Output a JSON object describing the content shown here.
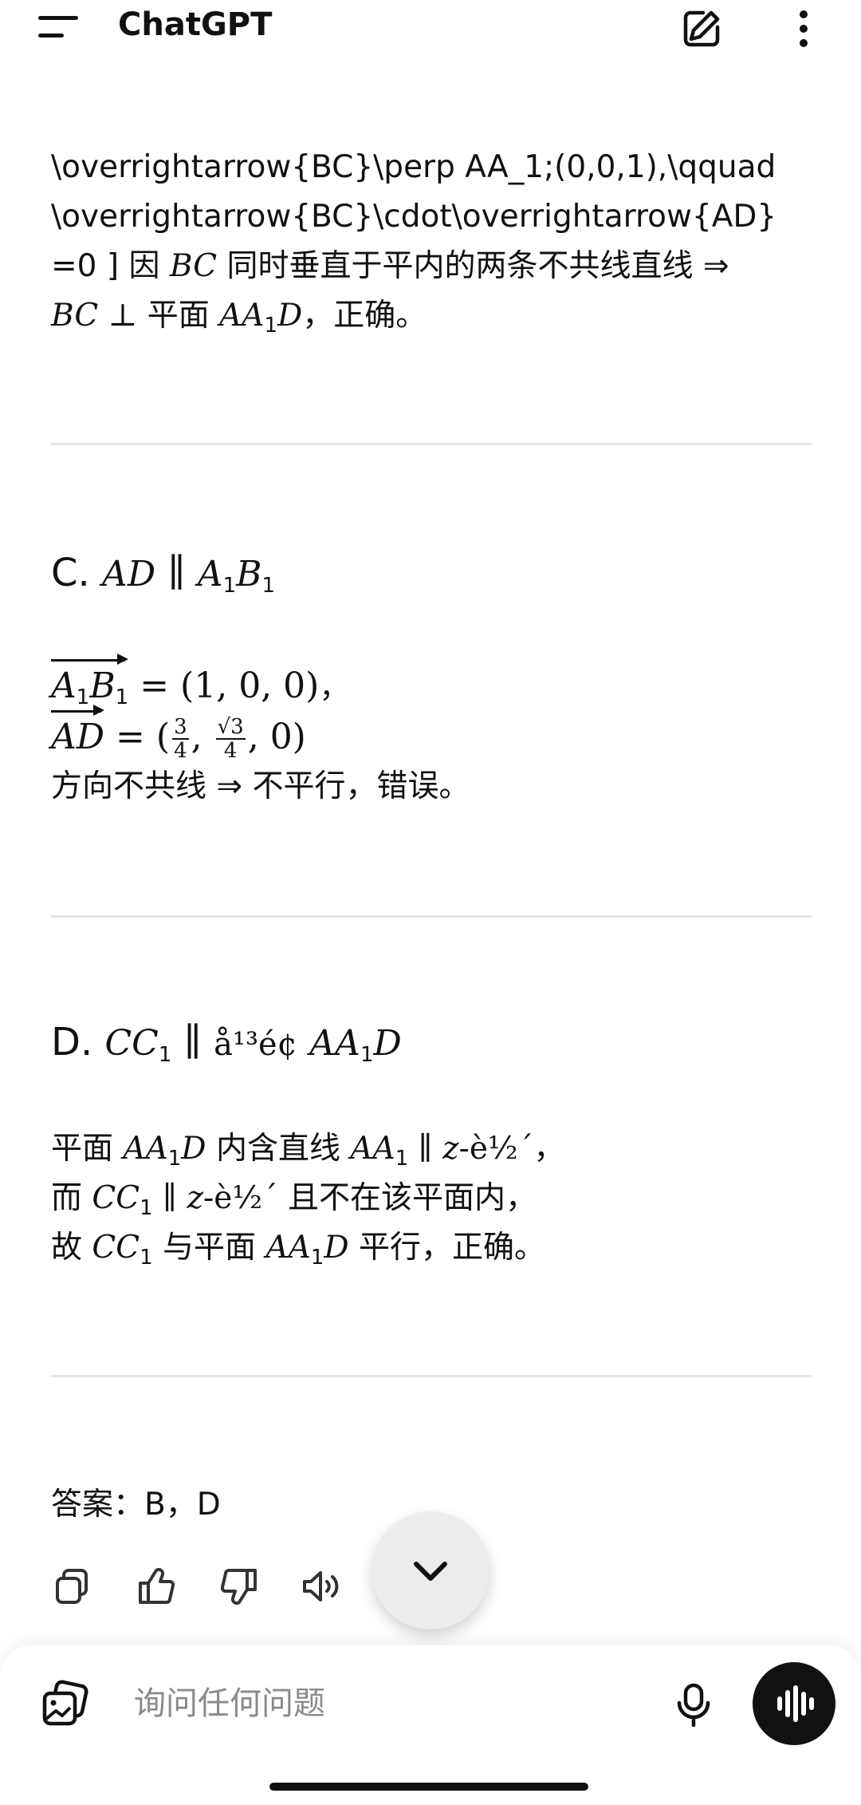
{
  "app": {
    "title": "ChatGPT"
  },
  "header_icons": [
    "menu-icon",
    "new-chat-edit-icon",
    "more-vert-icon"
  ],
  "section_b": {
    "line1": "\\overrightarrow{BC}\\perp AA_1;(0,0,1),\\qquad",
    "line2": "\\overrightarrow{BC}\\cdot\\overrightarrow{AD}",
    "line3_pre": "=0 ] 因 ",
    "line3_math": "BC",
    "line3_post": " 同时垂直于平内的两条不共线直线 ⇒",
    "line4_math1": "BC",
    "line4_perp": " ⊥ ",
    "line4_text1": "平面 ",
    "line4_math2": "AA",
    "line4_sub": "1",
    "line4_math3": "D",
    "line4_post": "，正确。"
  },
  "section_c": {
    "label": "C.",
    "head_m1": "AD",
    "head_par": " ∥ ",
    "head_m2": "A",
    "head_s1": "1",
    "head_m3": "B",
    "head_s2": "1",
    "vec1_a": "A",
    "vec1_s1": "1",
    "vec1_b": "B",
    "vec1_s2": "1",
    "vec1_value": " = (1, 0, 0)",
    "vec1_comma": "，",
    "vec2_name": "AD",
    "vec2_eq": " = (",
    "vec2_f1_num": "3",
    "vec2_f1_den": "4",
    "vec2_sep": ", ",
    "vec2_f2_num": "√3",
    "vec2_f2_den": "4",
    "vec2_tail": ", 0)",
    "conclusion": "方向不共线 ⇒ 不平行，错误。"
  },
  "section_d": {
    "label": "D.",
    "head_m1": "CC",
    "head_s1": "1",
    "head_par": " ∥ ",
    "head_garbled": "å¹³é¢",
    "head_m2": "AA",
    "head_s2": "1",
    "head_m3": "D",
    "l1_pre": "平面 ",
    "l1_m1": "AA",
    "l1_s1": "1",
    "l1_m2": "D",
    "l1_mid": " 内含直线 ",
    "l1_m3": "AA",
    "l1_s2": "1",
    "l1_par": " ∥ ",
    "l1_z": "z",
    "l1_garbled": "-è½´",
    "l1_end": "，",
    "l2_pre": "而 ",
    "l2_m1": "CC",
    "l2_s1": "1",
    "l2_par": " ∥ ",
    "l2_z": "z",
    "l2_garbled": "-è½´",
    "l2_post": " 且不在该平面内，",
    "l3_pre": "故 ",
    "l3_m1": "CC",
    "l3_s1": "1",
    "l3_mid": " 与平面 ",
    "l3_m2": "AA",
    "l3_s2": "1",
    "l3_m3": "D",
    "l3_post": " 平行，正确。"
  },
  "answer": "答案：B，D",
  "message_actions": [
    "copy-icon",
    "thumbs-up-icon",
    "thumbs-down-icon",
    "read-aloud-icon"
  ],
  "composer": {
    "placeholder": "询问任何问题"
  }
}
